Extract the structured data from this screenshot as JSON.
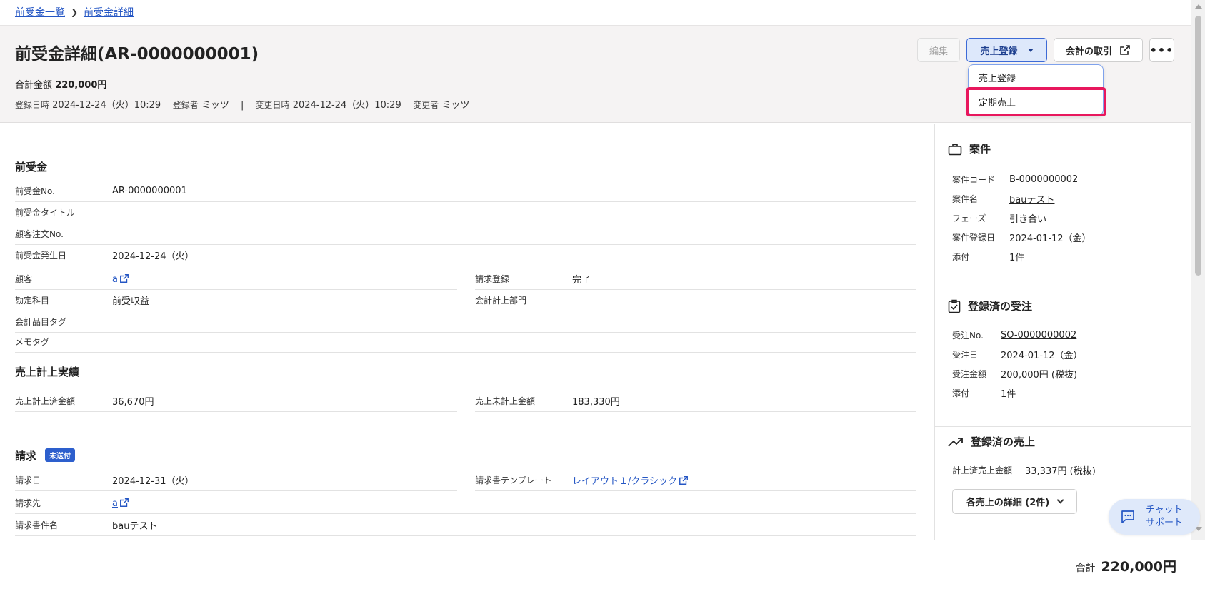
{
  "breadcrumb": {
    "items": [
      "前受金一覧",
      "前受金詳細"
    ]
  },
  "header": {
    "title": "前受金詳細(AR-0000000001)",
    "total_label": "合計金額",
    "total_value": "220,000円",
    "registered_at_label": "登録日時",
    "registered_at": "2024-12-24（火）10:29",
    "registered_by_label": "登録者",
    "registered_by": "ミッツ",
    "separator": "|",
    "updated_at_label": "変更日時",
    "updated_at": "2024-12-24（火）10:29",
    "updated_by_label": "変更者",
    "updated_by": "ミッツ",
    "buttons": {
      "edit": "編集",
      "sales_register": "売上登録",
      "accounting": "会計の取引",
      "more": "•••"
    },
    "dropdown": {
      "items": [
        "売上登録",
        "定期売上"
      ]
    }
  },
  "advance": {
    "title": "前受金",
    "rows": [
      {
        "label": "前受金No.",
        "value": "AR-0000000001"
      },
      {
        "label": "前受金タイトル",
        "value": ""
      },
      {
        "label": "顧客注文No.",
        "value": ""
      },
      {
        "label": "前受金発生日",
        "value": "2024-12-24（火）"
      }
    ],
    "customer_label": "顧客",
    "customer_value": "a",
    "billing_reg_label": "請求登録",
    "billing_reg_value": "完了",
    "account_label": "勘定科目",
    "account_value": "前受収益",
    "department_label": "会計計上部門",
    "department_value": "",
    "item_tag_label": "会計品目タグ",
    "item_tag_value": "",
    "memo_tag_label": "メモタグ",
    "memo_tag_value": ""
  },
  "sales_result": {
    "title": "売上計上実績",
    "booked_label": "売上計上済金額",
    "booked_value": "36,670円",
    "unbooked_label": "売上未計上金額",
    "unbooked_value": "183,330円"
  },
  "billing": {
    "title": "請求",
    "badge": "未送付",
    "date_label": "請求日",
    "date_value": "2024-12-31（火）",
    "template_label": "請求書テンプレート",
    "template_value": "レイアウト１/クラシック",
    "to_label": "請求先",
    "to_value": "a",
    "subject_label": "請求書件名",
    "subject_value": "bauテスト"
  },
  "sidebar": {
    "project": {
      "title": "案件",
      "rows": [
        {
          "label": "案件コード",
          "value": "B-0000000002"
        },
        {
          "label": "案件名",
          "value": "bauテスト"
        },
        {
          "label": "フェーズ",
          "value": "引き合い"
        },
        {
          "label": "案件登録日",
          "value": "2024-01-12（金）"
        },
        {
          "label": "添付",
          "value": "1件"
        }
      ]
    },
    "orders": {
      "title": "登録済の受注",
      "rows": [
        {
          "label": "受注No.",
          "value": "SO-0000000002"
        },
        {
          "label": "受注日",
          "value": "2024-01-12（金）"
        },
        {
          "label": "受注金額",
          "value": "200,000円 (税抜)"
        },
        {
          "label": "添付",
          "value": "1件"
        }
      ]
    },
    "sales": {
      "title": "登録済の売上",
      "booked_label": "計上済売上金額",
      "booked_value": "33,337円 (税抜)",
      "detail_button": "各売上の詳細 (2件)"
    }
  },
  "chat": {
    "line1": "チャット",
    "line2": "サポート"
  },
  "footer": {
    "total_label": "合計",
    "total_value": "220,000円"
  }
}
